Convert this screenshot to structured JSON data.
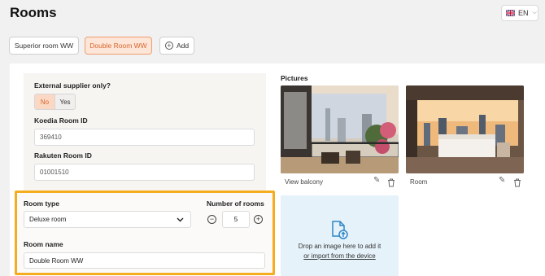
{
  "header": {
    "title": "Rooms",
    "language": "EN"
  },
  "tabs": [
    {
      "label": "Superior room WW",
      "active": false
    },
    {
      "label": "Double Room WW",
      "active": true
    }
  ],
  "add_label": "Add",
  "form": {
    "external_supplier_label": "External supplier only?",
    "toggle_no": "No",
    "toggle_yes": "Yes",
    "koedia_label": "Koedia Room ID",
    "koedia_value": "369410",
    "rakuten_label": "Rakuten Room ID",
    "rakuten_value": "01001510",
    "room_type_label": "Room type",
    "room_type_value": "Deluxe room",
    "number_of_rooms_label": "Number of rooms",
    "number_of_rooms_value": "5",
    "room_name_label": "Room name",
    "room_name_value": "Double Room WW"
  },
  "pictures": {
    "label": "Pictures",
    "items": [
      {
        "caption": "View balcony"
      },
      {
        "caption": "Room"
      }
    ],
    "drop_text": "Drop an image here to add it",
    "import_link": "or import from the device"
  },
  "colors": {
    "accent": "#ef9e70",
    "highlight": "#f5ac1e",
    "drop_zone": "#e5f2fa"
  }
}
